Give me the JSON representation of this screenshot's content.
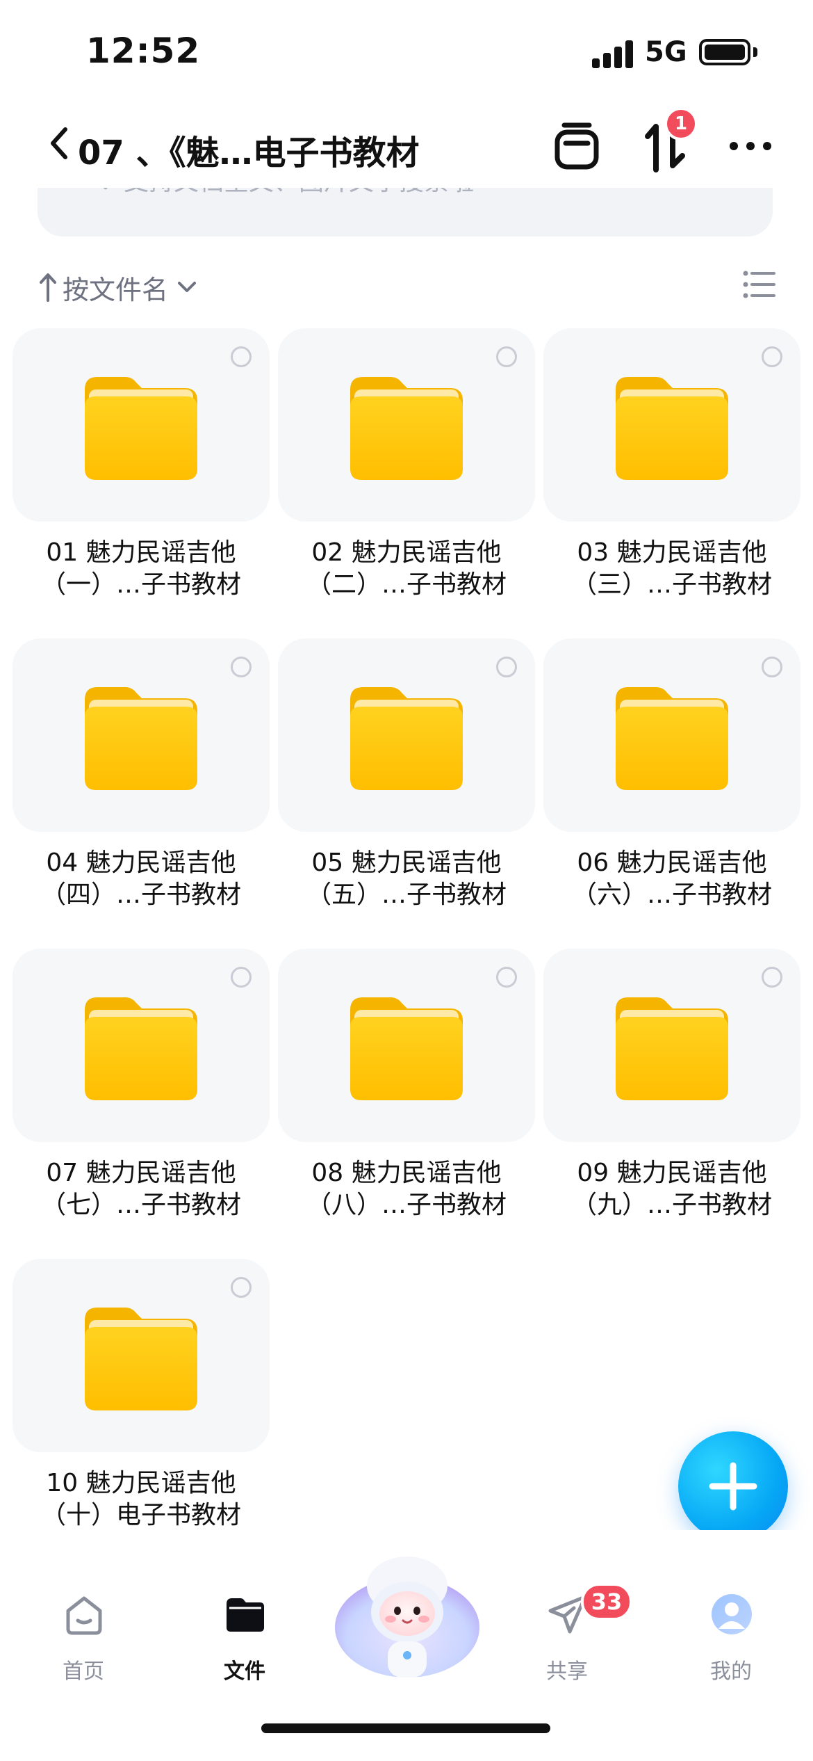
{
  "status_bar": {
    "time": "12:52",
    "network": "5G",
    "signal_bars": 4,
    "battery_icon": "battery-full-icon"
  },
  "nav": {
    "title": "07 、《魅…电子书教材",
    "back_icon": "chevron-left-icon",
    "actions": [
      {
        "icon": "cart-icon"
      },
      {
        "icon": "transfer-icon",
        "badge": "1"
      },
      {
        "icon": "more-icon"
      }
    ]
  },
  "search": {
    "placeholder": "支持文档全文、图片文字搜索啦"
  },
  "sort": {
    "label": "按文件名",
    "direction_icon": "arrow-up-icon",
    "view_icon": "list-view-icon"
  },
  "folders": [
    {
      "line1": "01 魅力民谣吉他",
      "line2": "（一）…子书教材"
    },
    {
      "line1": "02 魅力民谣吉他",
      "line2": "（二）…子书教材"
    },
    {
      "line1": "03 魅力民谣吉他",
      "line2": "（三）…子书教材"
    },
    {
      "line1": "04 魅力民谣吉他",
      "line2": "（四）…子书教材"
    },
    {
      "line1": "05 魅力民谣吉他",
      "line2": "（五）…子书教材"
    },
    {
      "line1": "06 魅力民谣吉他",
      "line2": "（六）…子书教材"
    },
    {
      "line1": "07 魅力民谣吉他",
      "line2": "（七）…子书教材"
    },
    {
      "line1": "08 魅力民谣吉他",
      "line2": "（八）…子书教材"
    },
    {
      "line1": "09 魅力民谣吉他",
      "line2": "（九）…子书教材"
    },
    {
      "line1": "10 魅力民谣吉他",
      "line2": "（十）电子书教材"
    }
  ],
  "fab": {
    "icon": "plus-icon"
  },
  "tabs": [
    {
      "label": "首页",
      "icon": "home-icon",
      "active": false
    },
    {
      "label": "文件",
      "icon": "folder-icon",
      "active": true
    },
    {
      "label": "",
      "icon": "mascot-icon",
      "active": false
    },
    {
      "label": "共享",
      "icon": "send-icon",
      "active": false,
      "badge": "33"
    },
    {
      "label": "我的",
      "icon": "avatar-icon",
      "active": false
    }
  ],
  "colors": {
    "accent": "#06a8f5",
    "badge": "#f24b5b",
    "folder_yellow": "#ffc400",
    "muted_text": "#8b8f9c"
  }
}
